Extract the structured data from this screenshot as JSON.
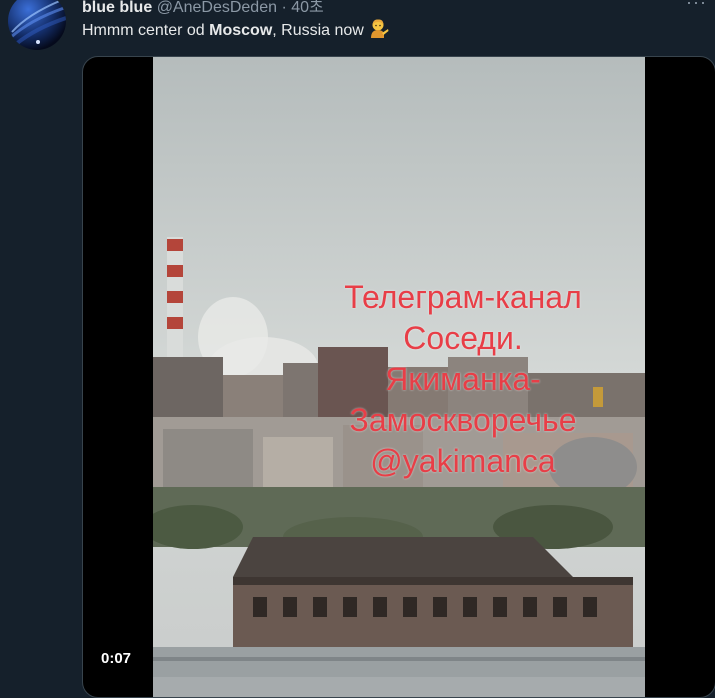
{
  "tweet": {
    "author_name": "blue blue",
    "author_handle": "@AneDesDeden",
    "time_ago": "· 40초",
    "more_label": "···",
    "text_before": "Hmmm center od ",
    "text_bold": "Moscow",
    "text_after": ", Russia now",
    "emoji_name": "person-tipping-hand-emoji"
  },
  "video": {
    "overlay_lines": [
      "Телеграм-канал",
      "Соседи.",
      "Якиманка-",
      "Замоскворечье",
      "@yakimanca"
    ],
    "timestamp": "0:07"
  }
}
